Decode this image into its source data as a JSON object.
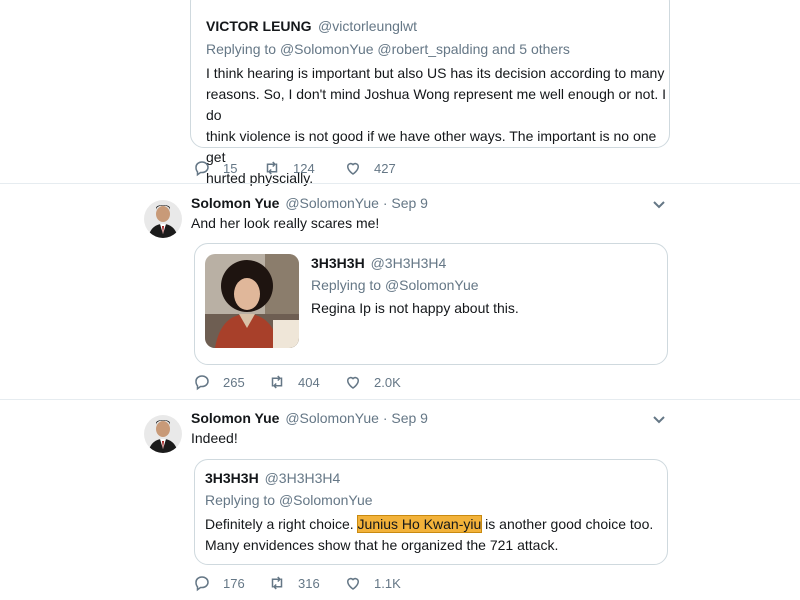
{
  "colors": {
    "accent": "#1da1f2",
    "muted": "#657786",
    "highlight": "#f2b23a"
  },
  "tweet1": {
    "name": "VICTOR LEUNG",
    "handle": "@victorleunglwt",
    "reply_prefix": "Replying to ",
    "reply_users": "@SolomonYue @robert_spalding",
    "reply_suffix": " and 5 others",
    "lines": [
      "I think hearing is important but also US has its decision according to many",
      "reasons. So, I don't mind Joshua Wong represent me well enough or not. I do",
      "think violence is not good if we have other ways. The important is no one get",
      "hurted physcially."
    ],
    "replies": "15",
    "retweets": "124",
    "likes": "427"
  },
  "tweet2": {
    "name": "Solomon Yue",
    "handle": "@SolomonYue · Sep 9",
    "text": "And her look really scares me!",
    "quote": {
      "name": "3H3H3H",
      "handle": "@3H3H3H4",
      "reply_prefix": "Replying to ",
      "reply_user": "@SolomonYue",
      "text": "Regina Ip is not happy about this."
    },
    "replies": "265",
    "retweets": "404",
    "likes": "2.0K"
  },
  "tweet3": {
    "name": "Solomon Yue",
    "handle": "@SolomonYue · Sep 9",
    "text": "Indeed!",
    "quote": {
      "name": "3H3H3H",
      "handle": "@3H3H3H4",
      "reply_prefix": "Replying to ",
      "reply_user": "@SolomonYue",
      "line1_before": "Definitely a right choice. ",
      "line1_highlight": "Junius Ho Kwan-yiu",
      "line1_after": " is another good choice too.",
      "line2": "Many envidences show that he organized the 721 attack."
    },
    "replies": "176",
    "retweets": "316",
    "likes": "1.1K"
  }
}
